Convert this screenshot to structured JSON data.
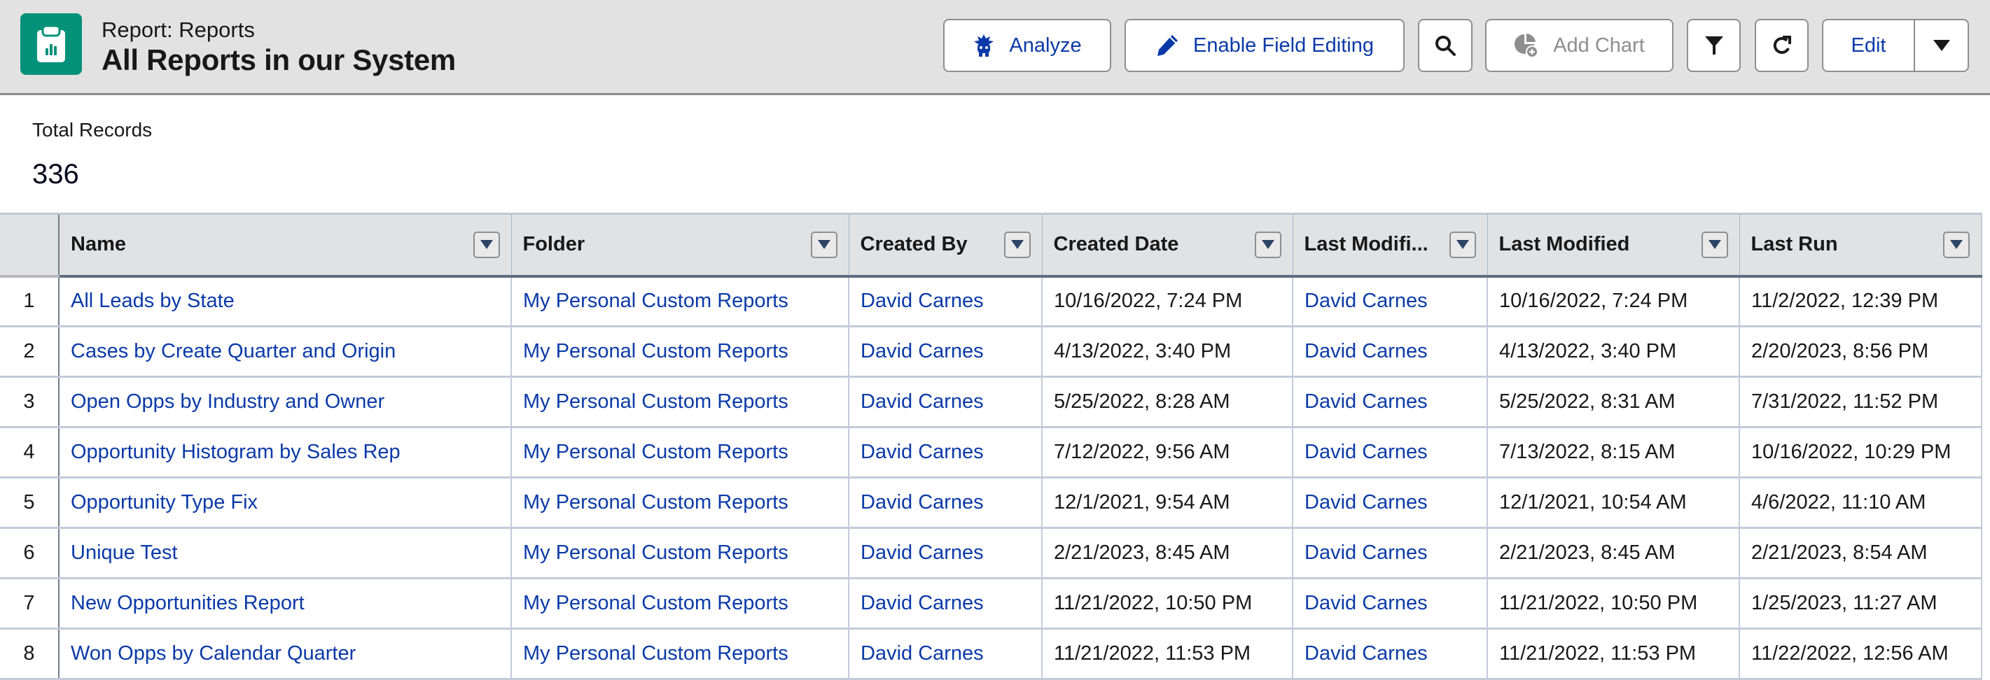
{
  "header": {
    "object_label": "Report: Reports",
    "title": "All Reports in our System",
    "icon": "report-clipboard-icon",
    "accent_color": "#04917a"
  },
  "toolbar": {
    "analyze_label": "Analyze",
    "analyze_icon": "einstein-icon",
    "enable_field_editing_label": "Enable Field Editing",
    "enable_field_editing_icon": "pencil-icon",
    "search_icon": "search-icon",
    "add_chart_label": "Add Chart",
    "add_chart_icon": "add-chart-icon",
    "filter_icon": "filter-icon",
    "refresh_icon": "refresh-icon",
    "edit_label": "Edit",
    "edit_menu_icon": "chevron-down-icon",
    "link_color": "#0b3aa8"
  },
  "summary": {
    "label": "Total Records",
    "value": "336"
  },
  "table": {
    "columns": [
      {
        "label": "Name"
      },
      {
        "label": "Folder"
      },
      {
        "label": "Created By"
      },
      {
        "label": "Created Date"
      },
      {
        "label": "Last Modifi..."
      },
      {
        "label": "Last Modified"
      },
      {
        "label": "Last Run"
      }
    ],
    "rows": [
      {
        "num": "1",
        "name": "All Leads by State",
        "folder": "My Personal Custom Reports",
        "created_by": "David Carnes",
        "created_date": "10/16/2022, 7:24 PM",
        "last_modified_by": "David Carnes",
        "last_modified": "10/16/2022, 7:24 PM",
        "last_run": "11/2/2022, 12:39 PM"
      },
      {
        "num": "2",
        "name": "Cases by Create Quarter and Origin",
        "folder": "My Personal Custom Reports",
        "created_by": "David Carnes",
        "created_date": "4/13/2022, 3:40 PM",
        "last_modified_by": "David Carnes",
        "last_modified": "4/13/2022, 3:40 PM",
        "last_run": "2/20/2023, 8:56 PM"
      },
      {
        "num": "3",
        "name": "Open Opps by Industry and Owner",
        "folder": "My Personal Custom Reports",
        "created_by": "David Carnes",
        "created_date": "5/25/2022, 8:28 AM",
        "last_modified_by": "David Carnes",
        "last_modified": "5/25/2022, 8:31 AM",
        "last_run": "7/31/2022, 11:52 PM"
      },
      {
        "num": "4",
        "name": "Opportunity Histogram by Sales Rep",
        "folder": "My Personal Custom Reports",
        "created_by": "David Carnes",
        "created_date": "7/12/2022, 9:56 AM",
        "last_modified_by": "David Carnes",
        "last_modified": "7/13/2022, 8:15 AM",
        "last_run": "10/16/2022, 10:29 PM"
      },
      {
        "num": "5",
        "name": "Opportunity Type Fix",
        "folder": "My Personal Custom Reports",
        "created_by": "David Carnes",
        "created_date": "12/1/2021, 9:54 AM",
        "last_modified_by": "David Carnes",
        "last_modified": "12/1/2021, 10:54 AM",
        "last_run": "4/6/2022, 11:10 AM"
      },
      {
        "num": "6",
        "name": "Unique Test",
        "folder": "My Personal Custom Reports",
        "created_by": "David Carnes",
        "created_date": "2/21/2023, 8:45 AM",
        "last_modified_by": "David Carnes",
        "last_modified": "2/21/2023, 8:45 AM",
        "last_run": "2/21/2023, 8:54 AM"
      },
      {
        "num": "7",
        "name": "New Opportunities Report",
        "folder": "My Personal Custom Reports",
        "created_by": "David Carnes",
        "created_date": "11/21/2022, 10:50 PM",
        "last_modified_by": "David Carnes",
        "last_modified": "11/21/2022, 10:50 PM",
        "last_run": "1/25/2023, 11:27 AM"
      },
      {
        "num": "8",
        "name": "Won Opps by Calendar Quarter",
        "folder": "My Personal Custom Reports",
        "created_by": "David Carnes",
        "created_date": "11/21/2022, 11:53 PM",
        "last_modified_by": "David Carnes",
        "last_modified": "11/21/2022, 11:53 PM",
        "last_run": "11/22/2022, 12:56 AM"
      }
    ]
  }
}
